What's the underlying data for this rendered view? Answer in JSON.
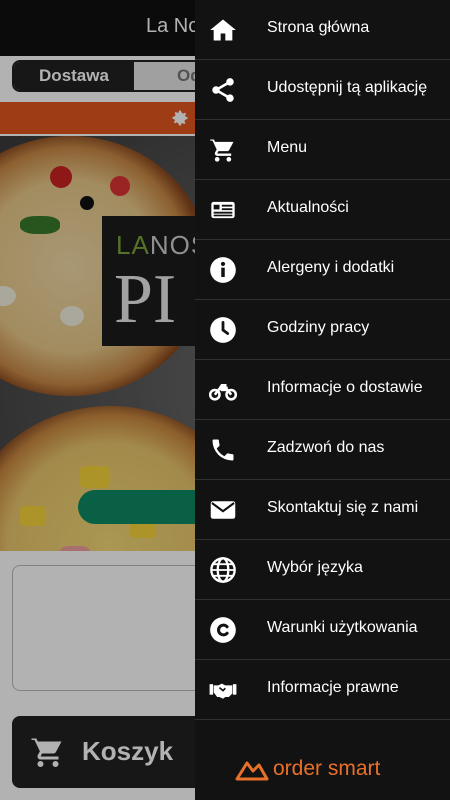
{
  "app": {
    "title": "La No",
    "tabs": [
      {
        "label": "Dostawa",
        "active": true
      },
      {
        "label": "Odb",
        "active": false
      }
    ],
    "hero_logo": {
      "small_text_accent": "LA",
      "small_text_rest": "NOS",
      "big_text": "PI"
    },
    "cart_label": "Koszyk",
    "colors": {
      "banner": "#e2571f",
      "order_button": "#0f8a62",
      "header": "#111111"
    }
  },
  "drawer": {
    "items": [
      {
        "label": "Strona główna",
        "icon": "home-icon"
      },
      {
        "label": "Udostępnij tą aplikację",
        "icon": "share-icon"
      },
      {
        "label": "Menu",
        "icon": "cart-icon"
      },
      {
        "label": "Aktualności",
        "icon": "newspaper-icon"
      },
      {
        "label": "Alergeny i dodatki",
        "icon": "info-icon"
      },
      {
        "label": "Godziny pracy",
        "icon": "clock-icon"
      },
      {
        "label": "Informacje o dostawie",
        "icon": "motorcycle-icon"
      },
      {
        "label": "Zadzwoń do nas",
        "icon": "phone-icon"
      },
      {
        "label": "Skontaktuj się z nami",
        "icon": "envelope-icon"
      },
      {
        "label": "Wybór języka",
        "icon": "globe-icon"
      },
      {
        "label": "Warunki użytkowania",
        "icon": "copyright-icon"
      },
      {
        "label": "Informacje prawne",
        "icon": "handshake-icon"
      }
    ],
    "brand": {
      "text": "order smart",
      "color": "#e8702a"
    }
  }
}
